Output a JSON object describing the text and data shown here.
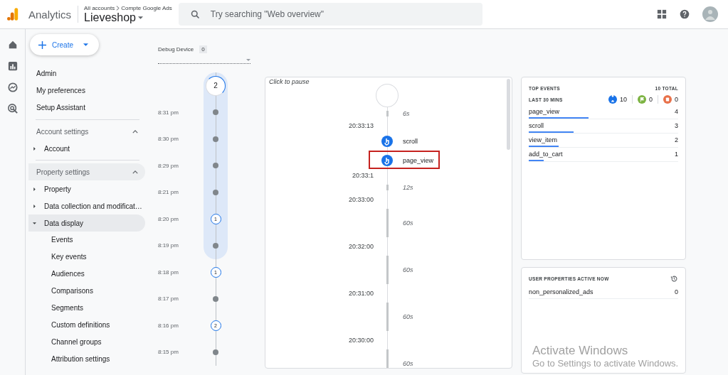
{
  "header": {
    "product": "Analytics",
    "breadcrumb": [
      "All accounts",
      "Compte Google Ads"
    ],
    "property": "Lieveshop",
    "search": {
      "placeholder": "Try searching \"Web overview\""
    }
  },
  "create_button": "Create",
  "sidebar": [
    {
      "kind": "link",
      "label": "Admin"
    },
    {
      "kind": "link",
      "label": "My preferences"
    },
    {
      "kind": "link",
      "label": "Setup Assistant"
    },
    {
      "kind": "section",
      "label": "Account settings",
      "expanded": true,
      "highlighted": false,
      "children": [
        {
          "label": "Account",
          "expanded": false,
          "selected": false
        }
      ]
    },
    {
      "kind": "section",
      "label": "Property settings",
      "expanded": true,
      "highlighted": true,
      "children": [
        {
          "label": "Property",
          "expanded": false,
          "selected": false
        },
        {
          "label": "Data collection and modificat…",
          "expanded": false,
          "selected": false
        },
        {
          "label": "Data display",
          "expanded": true,
          "selected": true,
          "children": [
            {
              "label": "Events"
            },
            {
              "label": "Key events"
            },
            {
              "label": "Audiences"
            },
            {
              "label": "Comparisons"
            },
            {
              "label": "Segments"
            },
            {
              "label": "Custom definitions"
            },
            {
              "label": "Channel groups"
            },
            {
              "label": "Attribution settings"
            }
          ]
        }
      ]
    }
  ],
  "debug_device": {
    "label": "Debug Device",
    "count": "0"
  },
  "minutes": [
    {
      "kind": "count",
      "count": "2",
      "highlighted": true
    },
    {
      "time": "8:31 pm",
      "kind": "dot",
      "highlighted": true
    },
    {
      "time": "8:30 pm",
      "kind": "dot",
      "highlighted": true
    },
    {
      "time": "8:29 pm",
      "kind": "dot",
      "highlighted": true
    },
    {
      "time": "8:21 pm",
      "kind": "dot",
      "highlighted": true
    },
    {
      "time": "8:20 pm",
      "kind": "count",
      "count": "1",
      "highlighted": true
    },
    {
      "time": "8:19 pm",
      "kind": "dot",
      "highlighted": true
    },
    {
      "time": "8:18 pm",
      "kind": "count",
      "count": "1",
      "highlighted": false
    },
    {
      "time": "8:17 pm",
      "kind": "dot",
      "highlighted": false
    },
    {
      "time": "8:16 pm",
      "kind": "count",
      "count": "2",
      "highlighted": false
    },
    {
      "time": "8:15 pm",
      "kind": "dot",
      "highlighted": false
    }
  ],
  "stream": {
    "hint": "Click to pause",
    "entries": [
      {
        "kind": "short_gap",
        "text": "6s"
      },
      {
        "kind": "time",
        "text": "20:33:13"
      },
      {
        "kind": "event",
        "text": "scroll",
        "highlighted": false
      },
      {
        "kind": "event",
        "text": "page_view",
        "highlighted": true
      },
      {
        "kind": "time",
        "text": "20:33:1"
      },
      {
        "kind": "short_gap",
        "text": "12s"
      },
      {
        "kind": "time",
        "text": "20:33:00"
      },
      {
        "kind": "long_gap",
        "text": "60s"
      },
      {
        "kind": "time",
        "text": "20:32:00"
      },
      {
        "kind": "long_gap",
        "text": "60s"
      },
      {
        "kind": "time",
        "text": "20:31:00"
      },
      {
        "kind": "long_gap",
        "text": "60s"
      },
      {
        "kind": "time",
        "text": "20:30:00"
      },
      {
        "kind": "long_gap",
        "text": "60s"
      }
    ]
  },
  "top_events": {
    "title": "TOP EVENTS",
    "total": "10 TOTAL",
    "period": "LAST 30 MINS",
    "counters": [
      {
        "kind": "event",
        "value": "10",
        "color": "#1a73e8"
      },
      {
        "kind": "conversion",
        "value": "0",
        "color": "#7cb342"
      },
      {
        "kind": "error",
        "value": "0",
        "color": "#e8714a"
      }
    ],
    "rows": [
      {
        "name": "page_view",
        "count": "4",
        "level": 0.4
      },
      {
        "name": "scroll",
        "count": "3",
        "level": 0.3
      },
      {
        "name": "view_item",
        "count": "2",
        "level": 0.2
      },
      {
        "name": "add_to_cart",
        "count": "1",
        "level": 0.1
      }
    ]
  },
  "user_properties": {
    "title": "USER PROPERTIES ACTIVE NOW",
    "rows": [
      {
        "name": "non_personalized_ads",
        "value": "0"
      }
    ]
  },
  "os_notice": {
    "title": "Activate Windows",
    "subtitle": "Go to Settings to activate Windows."
  }
}
